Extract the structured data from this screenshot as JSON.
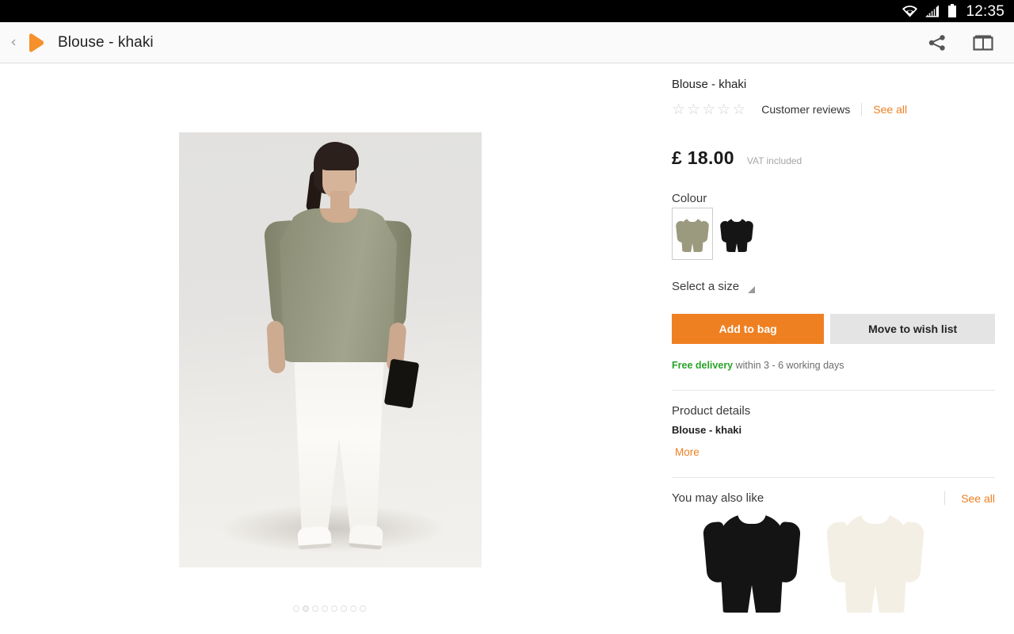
{
  "status_bar": {
    "time": "12:35",
    "icons": [
      "wifi-icon",
      "signal-icon",
      "battery-icon"
    ]
  },
  "app_bar": {
    "back_label": "‹",
    "logo_name": "otto-brand-logo",
    "title": "Blouse - khaki",
    "actions": [
      {
        "name": "share-icon",
        "label": "Share"
      },
      {
        "name": "catalogue-icon",
        "label": "Catalogue"
      }
    ]
  },
  "gallery": {
    "dot_count": 8,
    "active_dot_index": 1,
    "image_alt": "Model wearing khaki blouse with white trousers"
  },
  "product": {
    "name": "Blouse - khaki",
    "rating_value": 0,
    "star_count": 5,
    "reviews_label": "Customer reviews",
    "reviews_see_all": "See all",
    "price": "£ 18.00",
    "vat_note": "VAT included",
    "colour_label": "Colour",
    "colours": [
      {
        "name": "khaki",
        "hex": "#9b9a7f",
        "selected": true
      },
      {
        "name": "black",
        "hex": "#151515",
        "selected": false
      }
    ],
    "size_label": "Select a size",
    "size_selected": "",
    "add_to_bag_label": "Add to bag",
    "move_to_wishlist_label": "Move to wish list",
    "delivery_free_label": "Free delivery",
    "delivery_terms": " within 3 - 6 working days",
    "details_heading": "Product details",
    "details_name": "Blouse - khaki",
    "details_more_label": "More"
  },
  "recommendations": {
    "title": "You may also like",
    "see_all": "See all",
    "items": [
      {
        "name": "blouse-black",
        "hex": "#141414"
      },
      {
        "name": "blouse-cream",
        "hex": "#f3efe4"
      }
    ]
  },
  "colors": {
    "accent_orange": "#ef8022",
    "delivery_green": "#2aa32a",
    "button_grey": "#e4e4e4",
    "status_bar_black": "#000000",
    "app_bar_grey": "#fafafa"
  }
}
